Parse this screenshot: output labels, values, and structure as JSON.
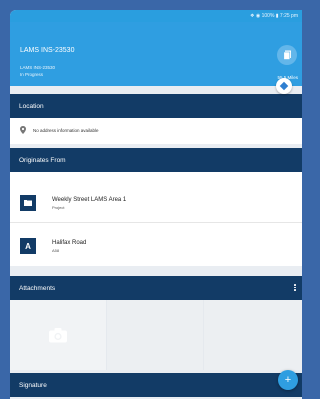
{
  "status_bar": {
    "text": "❖ ◉ 100% ▮ 7:25 pm"
  },
  "header": {
    "title": "LAMS INS-23530",
    "ref": "LAMS INS-23530",
    "status": "In Progress",
    "distance": "55.5 Miles"
  },
  "location": {
    "heading": "Location",
    "address": "No address information available"
  },
  "originates": {
    "heading": "Originates From",
    "items": [
      {
        "title": "Weekly Street LAMS Area 1",
        "subtitle": "Project",
        "icon_letter": ""
      },
      {
        "title": "Halifax Road",
        "subtitle": "A58",
        "icon_letter": "A"
      }
    ]
  },
  "attachments": {
    "heading": "Attachments"
  },
  "signature": {
    "heading": "Signature"
  },
  "fab": {
    "add_label": "+"
  },
  "colors": {
    "header_blue": "#2f9ee1",
    "navy": "#123b66",
    "page_bg": "#3a67a8"
  }
}
